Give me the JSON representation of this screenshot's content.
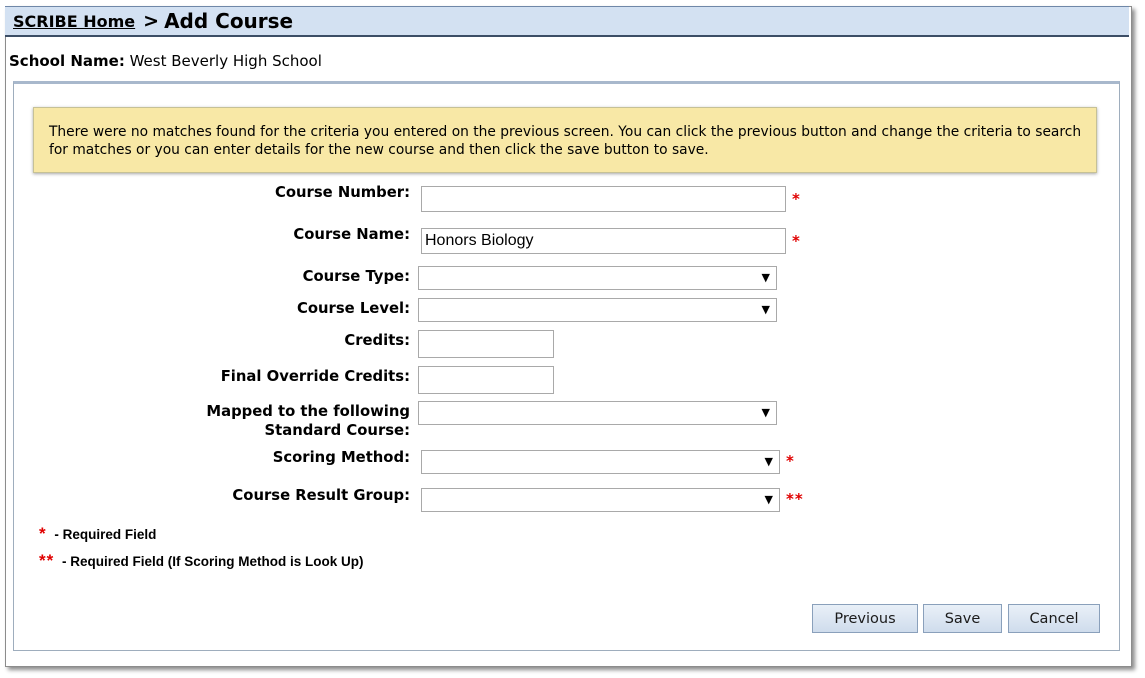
{
  "header": {
    "home_link": "SCRIBE Home",
    "separator": ">",
    "title": "Add Course"
  },
  "school": {
    "label": "School Name:",
    "value": "West Beverly High School"
  },
  "notice": {
    "text": "There were no matches found for the criteria you entered on the previous screen. You can click the previous button and change the criteria to search for matches or you can enter details for the new course and then click the save button to save."
  },
  "form": {
    "course_number": {
      "label": "Course Number:",
      "value": "",
      "required_mark": "*"
    },
    "course_name": {
      "label": "Course Name:",
      "value": "Honors Biology",
      "required_mark": "*"
    },
    "course_type": {
      "label": "Course Type:",
      "selected": ""
    },
    "course_level": {
      "label": "Course Level:",
      "selected": ""
    },
    "credits": {
      "label": "Credits:",
      "value": ""
    },
    "final_override_credits": {
      "label": "Final Override Credits:",
      "value": ""
    },
    "standard_course": {
      "label_line1": "Mapped to the following",
      "label_line2": "Standard Course:",
      "selected": ""
    },
    "scoring_method": {
      "label": "Scoring Method:",
      "selected": "",
      "required_mark": "*"
    },
    "course_result_group": {
      "label": "Course Result Group:",
      "selected": "",
      "required_mark": "**"
    }
  },
  "legend": {
    "single_mark": "*",
    "single_text": "- Required Field",
    "double_mark": "**",
    "double_text": "- Required Field (If Scoring Method is Look Up)"
  },
  "buttons": {
    "previous": "Previous",
    "save": "Save",
    "cancel": "Cancel"
  },
  "colors": {
    "header_bg": "#d3e1f2",
    "notice_bg": "#f8e8a6",
    "required": "#e00000",
    "button_bg": "#dbe6f3"
  },
  "icons": {
    "dropdown": "chevron-down-icon"
  }
}
